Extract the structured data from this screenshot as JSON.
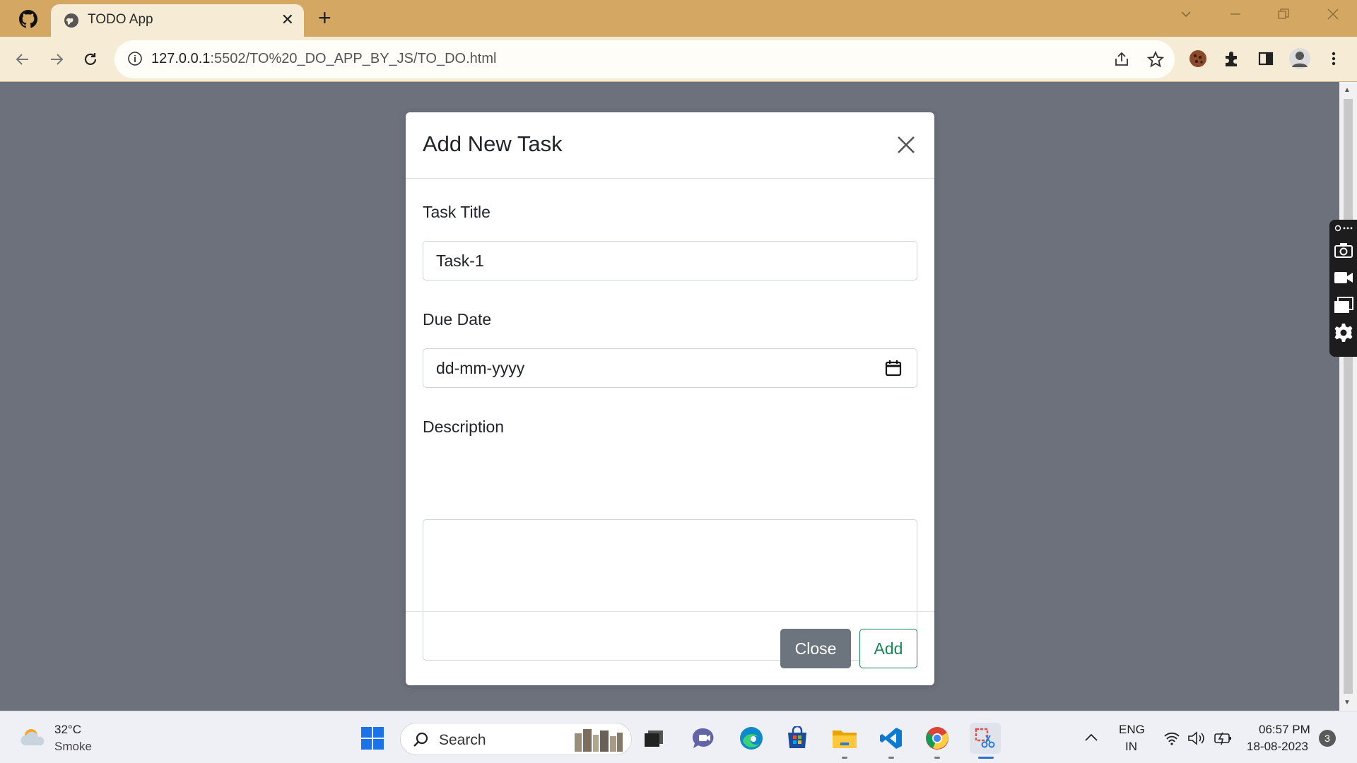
{
  "browser": {
    "tab_title": "TODO App",
    "tab_close_glyph": "✕",
    "new_tab_glyph": "+",
    "url_host": "127.0.0.1",
    "url_rest": ":5502/TO%20_DO_APP_BY_JS/TO_DO.html",
    "window_controls": [
      "⌄",
      "—",
      "❐",
      "✕"
    ]
  },
  "modal": {
    "title": "Add New Task",
    "task_title_label": "Task Title",
    "task_title_value": "Task-1",
    "due_date_label": "Due Date",
    "due_date_placeholder": "dd-mm-yyyy",
    "description_label": "Description",
    "description_value": "",
    "close_button": "Close",
    "add_button": "Add"
  },
  "taskbar": {
    "weather_temp": "32°C",
    "weather_condition": "Smoke",
    "search_placeholder": "Search",
    "language_line1": "ENG",
    "language_line2": "IN",
    "time": "06:57 PM",
    "date": "18-08-2023",
    "notification_count": "3"
  },
  "colors": {
    "tabstrip": "#d4a862",
    "toolbar": "#f6ecd6",
    "overlay": "#6c717b",
    "btn_secondary": "#6c757d",
    "btn_success_outline": "#198754"
  }
}
